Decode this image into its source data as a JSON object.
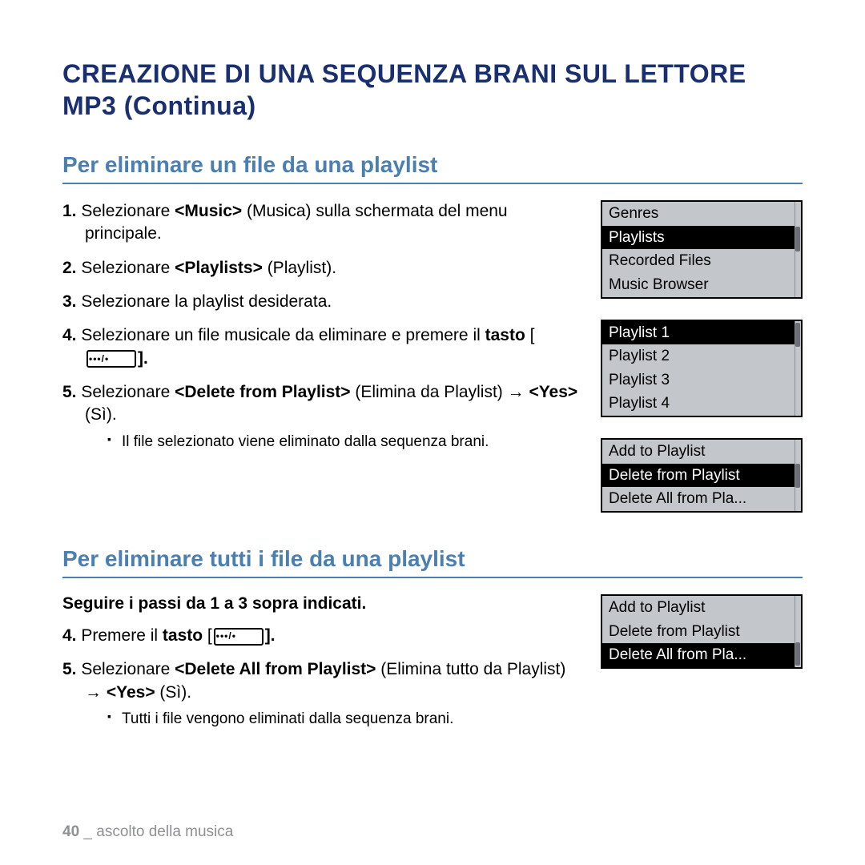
{
  "title": "CREAZIONE DI UNA SEQUENZA BRANI SUL LETTORE MP3 (Continua)",
  "section1": {
    "head": "Per eliminare un file da una playlist",
    "s1_a": "1.",
    "s1_b": "Selezionare ",
    "s1_c": "<Music>",
    "s1_d": " Musica) sulla schermata del menu principale.",
    "s2_a": "2.",
    "s2_b": "Selezionare ",
    "s2_c": "<Playlists>",
    "s2_d": " (Playlist).",
    "s3_a": "3.",
    "s3_b": "Selezionare la playlist desiderata.",
    "s4_a": "4.",
    "s4_b": "Selezionare un file musicale da eliminare e premere il ",
    "s4_c": "tasto",
    "s4_d": " [",
    "s4_e": "].",
    "s5_a": "5.",
    "s5_b": "Selezionare ",
    "s5_c": "<Delete from Playlist>",
    "s5_d": " (Elimina da Playlist) → ",
    "s5_e": "<Yes>",
    "s5_f": " (Sì).",
    "sub": "Il file selezionato viene eliminato dalla sequenza brani."
  },
  "section2": {
    "head": "Per eliminare tutti i file da una playlist",
    "lead": "Seguire i passi da 1 a 3 sopra indicati.",
    "s4_a": "4.",
    "s4_b": "Premere il ",
    "s4_c": "tasto",
    "s4_d": " [",
    "s4_e": "].",
    "s5_a": "5.",
    "s5_b": "Selezionare ",
    "s5_c": "<Delete All from Playlist>",
    "s5_d": " (Elimina tutto da Playlist) → ",
    "s5_e": "<Yes>",
    "s5_f": " (Sì).",
    "sub": "Tutti i file vengono eliminati dalla sequenza brani."
  },
  "menus": {
    "m1": {
      "r0": "Genres",
      "r1": "Playlists",
      "r2": "Recorded Files",
      "r3": "Music Browser"
    },
    "m2": {
      "r0": "Playlist 1",
      "r1": "Playlist 2",
      "r2": "Playlist 3",
      "r3": "Playlist 4"
    },
    "m3": {
      "r0": "Add to Playlist",
      "r1": "Delete from Playlist",
      "r2": "Delete All from Pla..."
    },
    "m4": {
      "r0": "Add to Playlist",
      "r1": "Delete from Playlist",
      "r2": "Delete All from Pla..."
    }
  },
  "footer": {
    "page": "40",
    "sep": " _ ",
    "chapter": "ascolto della musica"
  }
}
